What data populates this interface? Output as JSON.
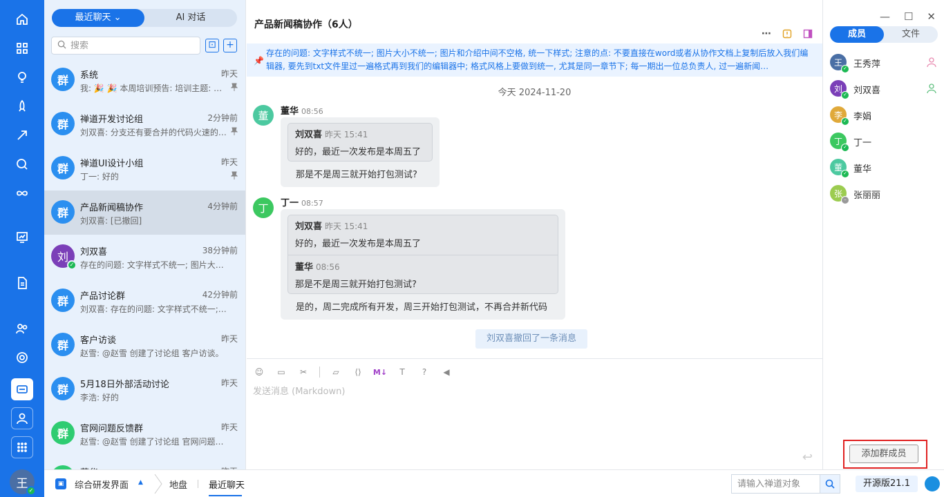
{
  "rail": {
    "items": [
      "home-icon",
      "apps-icon",
      "lightbulb-icon",
      "rocket-icon",
      "sprint-icon",
      "search-icon",
      "infinity-icon",
      "board-icon",
      "doc-icon",
      "users-icon",
      "settings-icon",
      "chat-icon",
      "user-icon",
      "grid-icon"
    ],
    "avatar": "王"
  },
  "chatlist": {
    "tabs": [
      "最近聊天 ⌄",
      "AI 对话"
    ],
    "search_placeholder": "搜索",
    "items": [
      {
        "avatar": "群",
        "name": "系统",
        "time": "昨天",
        "preview": "我: 🎉 🎉 本周培训预告: 培训主题: …",
        "pinned": true
      },
      {
        "avatar": "群",
        "name": "禅道开发讨论组",
        "time": "2分钟前",
        "preview": "刘双喜: 分支还有要合并的代码火速的…",
        "pinned": true
      },
      {
        "avatar": "群",
        "name": "禅道UI设计小组",
        "time": "昨天",
        "preview": "丁一: 好的",
        "pinned": true
      },
      {
        "avatar": "群",
        "name": "产品新闻稿协作",
        "time": "4分钟前",
        "preview": "刘双喜: [已撤回]",
        "pinned": false,
        "selected": true
      },
      {
        "avatar": "刘",
        "name": "刘双喜",
        "time": "38分钟前",
        "preview": "存在的问题: 文字样式不统一; 图片大…",
        "pinned": false
      },
      {
        "avatar": "群",
        "name": "产品讨论群",
        "time": "42分钟前",
        "preview": "刘双喜: 存在的问题: 文字样式不统一; …",
        "pinned": false
      },
      {
        "avatar": "群",
        "name": "客户访谈",
        "time": "昨天",
        "preview": "赵雪: @赵雪 创建了讨论组 客户访谈。",
        "pinned": false
      },
      {
        "avatar": "群",
        "name": "5月18日外部活动讨论",
        "time": "昨天",
        "preview": "李浩: 好的",
        "pinned": false
      },
      {
        "avatar": "群",
        "name": "官网问题反馈群",
        "time": "昨天",
        "preview": "赵雪: @赵雪 创建了讨论组 官网问题反…",
        "pinned": false
      },
      {
        "avatar": "群",
        "name": "董华",
        "time": "昨天",
        "preview": "",
        "pinned": false
      }
    ]
  },
  "chat": {
    "title": "产品新闻稿协作（6人）",
    "notice": "存在的问题: 文字样式不统一; 图片大小不统一; 图片和介绍中间不空格, 统一下样式; 注意的点: 不要直接在word或者从协作文档上复制后放入我们编辑器, 要先到txt文件里过一遍格式再到我们的编辑器中; 格式风格上要做到统一, 尤其是同一章节下; 每一期出一位总负责人, 过一遍新闻…",
    "date": "今天 2024-11-20",
    "messages": [
      {
        "avatar": "董",
        "sender": "董华",
        "time": "08:56",
        "quotes": [
          {
            "sender": "刘双喜",
            "time": "昨天 15:41",
            "text": "好的，最近一次发布是本周五了"
          }
        ],
        "text": "那是不是周三就开始打包测试?"
      },
      {
        "avatar": "丁",
        "sender": "丁一",
        "time": "08:57",
        "quotes": [
          {
            "sender": "刘双喜",
            "time": "昨天 15:41",
            "text": "好的，最近一次发布是本周五了"
          },
          {
            "sender": "董华",
            "time": "08:56",
            "text": "那是不是周三就开始打包测试?"
          }
        ],
        "text": "是的，周二完成所有开发，周三开始打包测试，不再合并新代码"
      }
    ],
    "recall_notice": "刘双喜撤回了一条消息",
    "editor_placeholder": "发送消息 (Markdown)",
    "editor_md": "M↓",
    "send_icon": "↩"
  },
  "members": {
    "tabs": [
      "成员",
      "文件"
    ],
    "list": [
      {
        "avatar": "王",
        "name": "王秀萍",
        "status": "online",
        "role": "admin-pink"
      },
      {
        "avatar": "刘",
        "name": "刘双喜",
        "status": "online",
        "role": "admin-green"
      },
      {
        "avatar": "李",
        "name": "李娟",
        "status": "online",
        "role": ""
      },
      {
        "avatar": "丁",
        "name": "丁一",
        "status": "online",
        "role": ""
      },
      {
        "avatar": "董",
        "name": "董华",
        "status": "online",
        "role": ""
      },
      {
        "avatar": "张",
        "name": "张丽丽",
        "status": "offline",
        "role": ""
      }
    ],
    "add_button": "添加群成员"
  },
  "window": {
    "minimize": "—",
    "maximize": "☐",
    "close": "✕"
  },
  "bottom": {
    "app_name": "综合研发界面",
    "caret": "▲",
    "nav1": "地盘",
    "nav2": "最近聊天",
    "search_placeholder": "请输入禅道对象",
    "version": "开源版21.1"
  },
  "colors": {
    "primary": "#1a73e8",
    "list_bg": "#e8f1fc",
    "online": "#1db954",
    "highlight_box": "#e02020"
  }
}
